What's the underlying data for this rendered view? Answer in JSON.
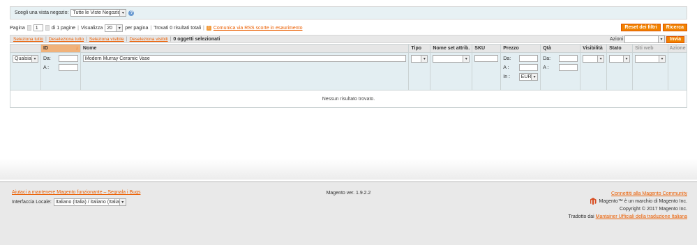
{
  "store_switcher": {
    "label": "Scegli una vista negozio:",
    "selected": "Tutte le Viste Negozio"
  },
  "pager": {
    "page_label": "Pagina",
    "page_value": "1",
    "of_pages": "di 1 pagine",
    "view_label": "Visualizza",
    "per_page": "20",
    "per_page_label": "per pagina",
    "found": "Trovati 0 risultati totali",
    "rss_link": "Comunica via RSS scorte in esaurimento"
  },
  "buttons": {
    "reset": "Reset dei filtri",
    "search": "Ricerca"
  },
  "massaction": {
    "select_all": "Seleziona tutto",
    "deselect_all": "Deseleziona tutto",
    "select_visible": "Seleziona visibile",
    "deselect_visible": "Deseleziona visibili",
    "selected_count": "0 oggetti selezionati",
    "actions_label": "Azioni",
    "submit": "Invia"
  },
  "grid": {
    "headers": {
      "id": "ID",
      "name": "Nome",
      "type": "Tipo",
      "attr_set": "Nome set attrib.",
      "sku": "SKU",
      "price": "Prezzo",
      "qty": "Qtà",
      "visibility": "Visibilità",
      "status": "Stato",
      "websites": "Siti web",
      "action": "Azione"
    },
    "filters": {
      "any": "Qualsiasi",
      "from": "Da:",
      "to": "A :",
      "in": "In :",
      "name_value": "Modern Murray Ceramic Vase",
      "currency": "EUR"
    },
    "empty_message": "Nessun risultato trovato."
  },
  "footer": {
    "help_link": "Aiutaci a mantenere Magento funzionante – Segnala i Bugs",
    "locale_label": "Interfaccia Locale:",
    "locale_value": "Italiano (Italia) / italiano (Italia)",
    "version": "Magento ver. 1.9.2.2",
    "community_link": "Connettiti alla Magento Community",
    "trademark": "Magento™ è un marchio di Magento Inc.",
    "copyright": "Copyright © 2017 Magento Inc.",
    "translated_by": "Tradotto dai",
    "translators_link": "Mantainer Ufficiali della traduzione Italiana"
  }
}
